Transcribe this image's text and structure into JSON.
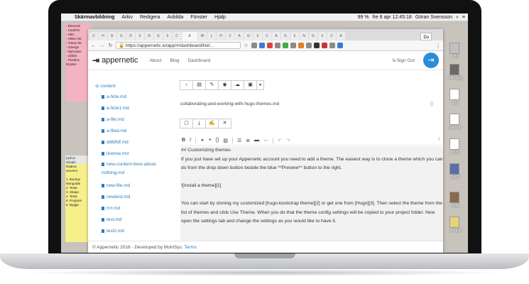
{
  "menubar": {
    "app_name": "Skärmavbildning",
    "items": [
      "Arkiv",
      "Redigera",
      "Avbilda",
      "Fönster",
      "Hjälp"
    ],
    "battery": "99 %",
    "clock": "fre 8 apr  12:45:18",
    "user": "Göran Svensson"
  },
  "browser": {
    "url": "https://appernetic.io/app/#/dashboard/list/...",
    "profile": "Du"
  },
  "header": {
    "logo": "appernetic",
    "nav": [
      "About",
      "Blog",
      "Dashboard"
    ],
    "signout": "Sign Out"
  },
  "sidebar": {
    "root": "content",
    "files": [
      "a-ficle.md",
      "a-ficle1.md",
      "a-file.md",
      "a-filed.md",
      "ddfdfdf.md",
      "license.md",
      "new-content-here-about-nothing.md",
      "new-file.md",
      "newtest.md",
      "rrrr.md",
      "test.md",
      "test2.md"
    ]
  },
  "editor": {
    "filename": "collaborating-and-working-with-hugo-themes.md",
    "lines": [
      "## Customizing themes",
      "If you just have set up your Appernetic account you need to add a theme. The easiest way is to clone a theme which you can do from the drop down button beside the blue **Preview** button to the right.",
      "",
      "![Install a theme][1]",
      "",
      "You can start by cloning my customized [hugo-bootstrap theme][2] or get one from [Hugo][3]. Then select the theme from the list of themes and click Use Theme. When you do that the theme config settings will be copied to your project folder. Now open the settings tab and change the settings as you would like to have it."
    ]
  },
  "footer": {
    "text": "© Appernetic 2016 - Developed by MolnSys.",
    "link": "Terms"
  },
  "desktop": {
    "icons": [
      "...HD",
      "...tiern.jpg",
      "...3u",
      "...tiern.rtf",
      "...m3u",
      "...pia 2",
      "...opia",
      "...data.js"
    ]
  },
  "colors": {
    "accent": "#2a8dd8",
    "link": "#2a7fbf"
  }
}
